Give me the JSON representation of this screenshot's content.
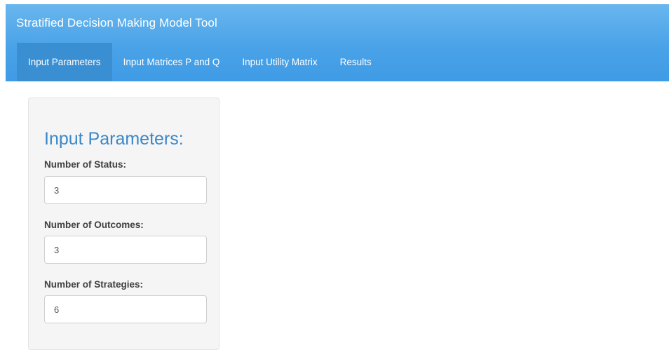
{
  "app": {
    "title": "Stratified Decision Making Model Tool"
  },
  "nav": {
    "tabs": [
      {
        "label": "Input Parameters",
        "active": true
      },
      {
        "label": "Input Matrices P and Q",
        "active": false
      },
      {
        "label": "Input Utility Matrix",
        "active": false
      },
      {
        "label": "Results",
        "active": false
      }
    ]
  },
  "panel": {
    "title": "Input Parameters:",
    "fields": [
      {
        "label": "Number of Status:",
        "value": "3"
      },
      {
        "label": "Number of Outcomes:",
        "value": "3"
      },
      {
        "label": "Number of Strategies:",
        "value": "6"
      }
    ]
  },
  "colors": {
    "navbar": "#4aa3e8",
    "active_tab": "#3a8fd2",
    "panel_title": "#3a87c8",
    "panel_bg": "#f5f5f5"
  }
}
